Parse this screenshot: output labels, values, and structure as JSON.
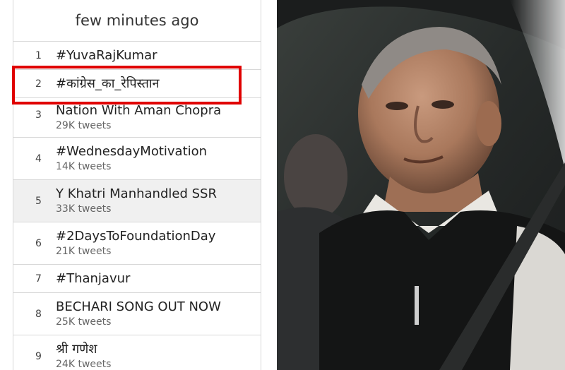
{
  "trends": {
    "header": "few minutes ago",
    "items": [
      {
        "rank": "1",
        "name": "#YuvaRajKumar",
        "count": ""
      },
      {
        "rank": "2",
        "name": "#कांग्रेस_का_रेपिस्तान",
        "count": ""
      },
      {
        "rank": "3",
        "name": "Nation With Aman Chopra",
        "count": "29K tweets"
      },
      {
        "rank": "4",
        "name": "#WednesdayMotivation",
        "count": "14K tweets"
      },
      {
        "rank": "5",
        "name": "Y Khatri Manhandled SSR",
        "count": "33K tweets"
      },
      {
        "rank": "6",
        "name": "#2DaysToFoundationDay",
        "count": "21K tweets"
      },
      {
        "rank": "7",
        "name": "#Thanjavur",
        "count": ""
      },
      {
        "rank": "8",
        "name": "BECHARI SONG OUT NOW",
        "count": "25K tweets"
      },
      {
        "rank": "9",
        "name": "श्री गणेश",
        "count": "24K tweets"
      }
    ]
  },
  "colors": {
    "highlight_border": "#e00000",
    "hover_row": "#f0f0f0"
  }
}
